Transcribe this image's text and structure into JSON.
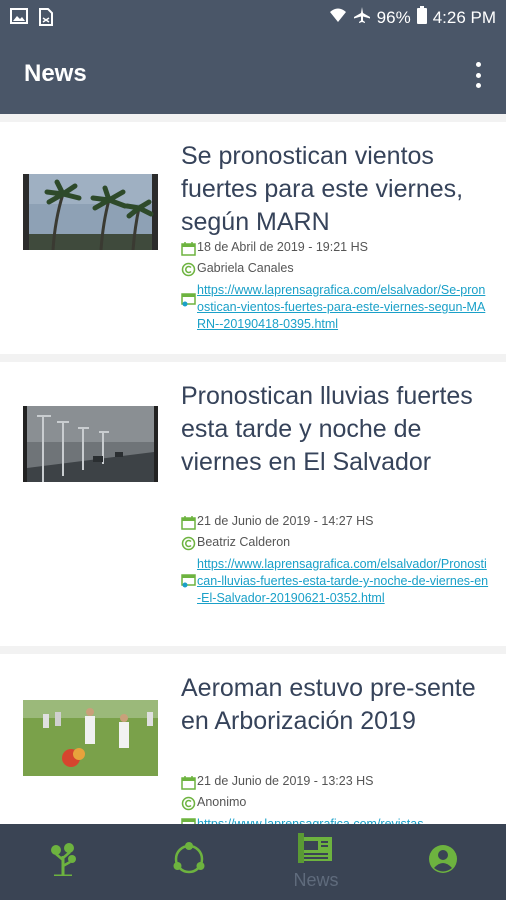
{
  "status_bar": {
    "battery": "96%",
    "time": "4:26 PM"
  },
  "app_bar": {
    "title": "News"
  },
  "articles": [
    {
      "title": "Se pronostican vientos fuertes para este viernes, según MARN",
      "date": "18 de Abril de 2019 - 19:21 HS",
      "author": "Gabriela Canales",
      "link": "https://www.laprensagrafica.com/elsalvador/Se-pronostican-vientos-fuertes-para-este-viernes-segun-MARN--20190418-0395.html"
    },
    {
      "title": "Pronostican lluvias fuertes esta tarde y noche de viernes en El Salvador",
      "date": "21 de Junio de 2019 - 14:27 HS",
      "author": "Beatriz Calderon",
      "link": "https://www.laprensagrafica.com/elsalvador/Pronostican-lluvias-fuertes-esta-tarde-y-noche-de-viernes-en-El-Salvador-20190621-0352.html"
    },
    {
      "title": "Aeroman estuvo pre-sente en Arborización 2019",
      "date": "21 de Junio de 2019 - 13:23 HS",
      "author": "Anonimo",
      "link": "https://www.laprensagrafica.com/revistas"
    }
  ],
  "bottom_nav": {
    "items": [
      {
        "icon": "tree-icon",
        "label": ""
      },
      {
        "icon": "cycle-icon",
        "label": ""
      },
      {
        "icon": "newspaper-icon",
        "label": "News"
      },
      {
        "icon": "account-icon",
        "label": ""
      }
    ]
  },
  "colors": {
    "accent": "#6db33f",
    "app_bar": "#4a5668",
    "link": "#1aa0c8"
  }
}
